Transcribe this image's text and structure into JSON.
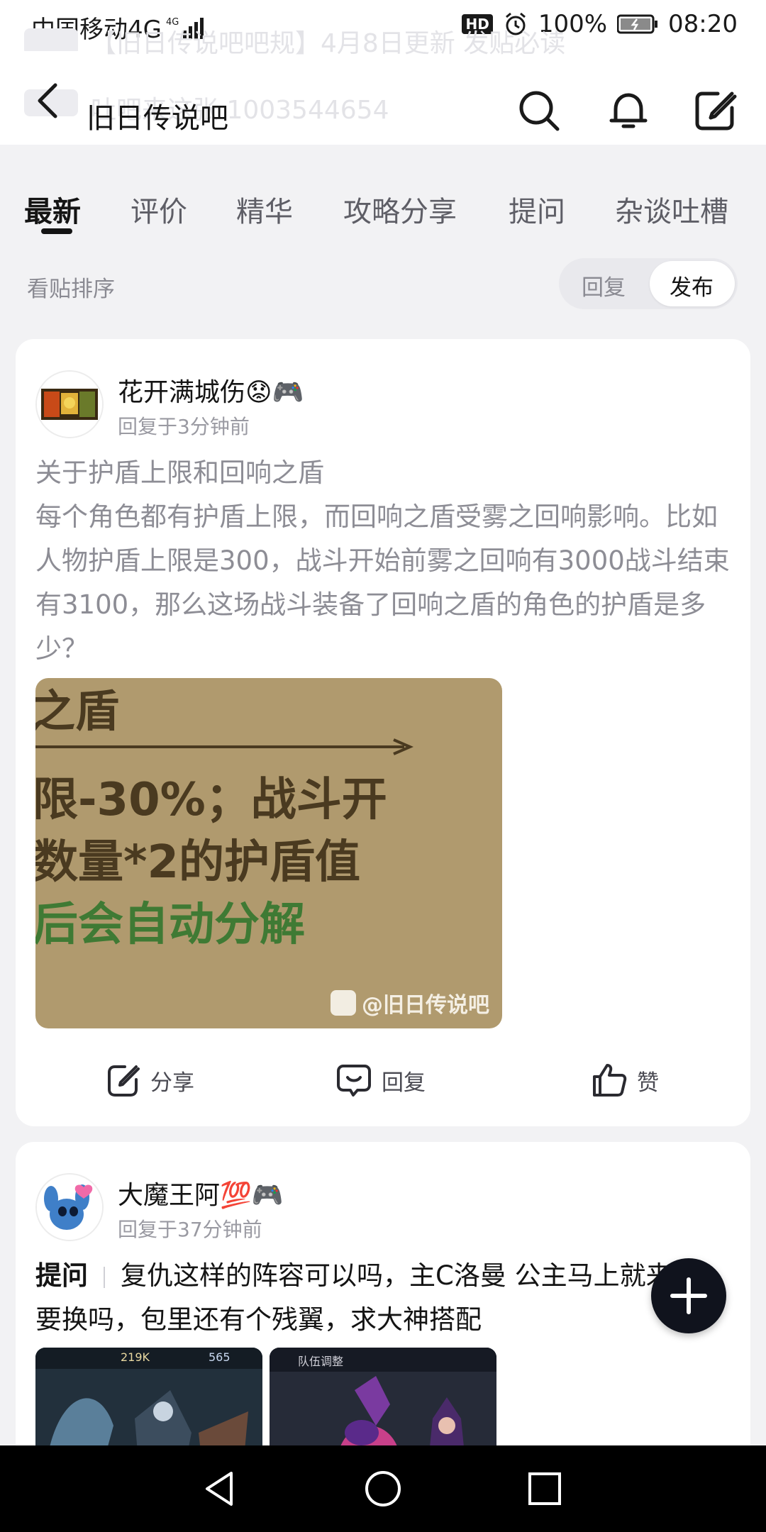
{
  "status_bar": {
    "carrier": "中国移动4G",
    "network_tag": "4G",
    "hd_badge": "HD",
    "battery": "100%",
    "time": "08:20"
  },
  "ghost_overlay": {
    "line1": "【旧日传说吧吧规】4月8日更新 发贴必读",
    "line2": "吐吧来这张 1003544654"
  },
  "header": {
    "title": "旧日传说吧"
  },
  "tabs": [
    {
      "label": "最新"
    },
    {
      "label": "评价"
    },
    {
      "label": "精华"
    },
    {
      "label": "攻略分享"
    },
    {
      "label": "提问"
    },
    {
      "label": "杂谈吐槽"
    }
  ],
  "sort": {
    "label": "看贴排序",
    "options": [
      "回复",
      "发布"
    ],
    "selected": "发布"
  },
  "posts": [
    {
      "username": "花开满城伤😟🎮",
      "time": "回复于3分钟前",
      "title": "关于护盾上限和回响之盾",
      "body": "每个角色都有护盾上限，而回响之盾受雾之回响影响。比如人物护盾上限是300，战斗开始前雾之回响有3000战斗结束有3100，那么这场战斗装备了回响之盾的角色的护盾是多少？",
      "image_text": {
        "line1": "之盾",
        "line2": "限-30%；战斗开",
        "line3": "数量*2的护盾值",
        "line4": "后会自动分解",
        "watermark": "@旧日传说吧"
      },
      "actions": {
        "share": "分享",
        "reply": "回复",
        "like": "赞"
      }
    },
    {
      "username": "大魔王阿💯🎮",
      "time": "回复于37分钟前",
      "tag": "提问",
      "body": "复仇这样的阵容可以吗，主C洛曼 公主马上就来了，要换吗，包里还有个残翼，求大神搭配",
      "thumb1_stats": [
        "219K",
        "565"
      ],
      "thumb2_text": "队伍调整"
    }
  ],
  "colors": {
    "page_bg": "#f2f2f4",
    "card_bg": "#ffffff",
    "fab_bg": "#10131d",
    "text_primary": "#141414",
    "text_secondary": "#8d8d95"
  },
  "icons": {
    "back": "back-arrow-icon",
    "search": "search-icon",
    "bell": "bell-icon",
    "edit": "edit-icon",
    "fab": "plus-icon"
  }
}
